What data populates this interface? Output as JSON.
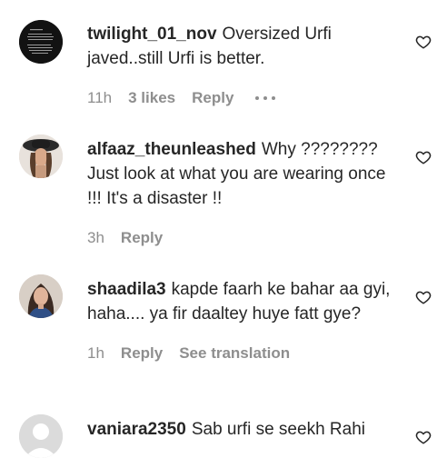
{
  "comments": [
    {
      "username": "twilight_01_nov",
      "text": "Oversized Urfi javed..still Urfi is better.",
      "time": "11h",
      "likes": "3 likes",
      "reply": "Reply",
      "avatar_text": "Hornaay Ivo Vear ataries the thuge chry Arrest to n, cure ro-omnante ct fount an atuth, acras exronten coanunt of thitst",
      "avatar_icon": "dark-text-avatar"
    },
    {
      "username": "alfaaz_theunleashed",
      "text": "Why ???????? Just look at what you are wearing once !!! It's a disaster !!",
      "time": "3h",
      "reply": "Reply",
      "avatar_icon": "photo-avatar-hat"
    },
    {
      "username": "shaadila3",
      "text": "kapde faarh ke bahar aa gyi, haha.... ya fir daaltey huye fatt gye?",
      "time": "1h",
      "reply": "Reply",
      "see_translation": "See translation",
      "avatar_icon": "photo-avatar-woman"
    },
    {
      "username": "vaniara2350",
      "text": "Sab urfi se seekh Rahi",
      "avatar_icon": "default-avatar"
    }
  ],
  "icons": {
    "like": "heart-outline-icon",
    "more": "more-options-icon"
  },
  "colors": {
    "text": "#262626",
    "muted": "#8e8e8e"
  }
}
